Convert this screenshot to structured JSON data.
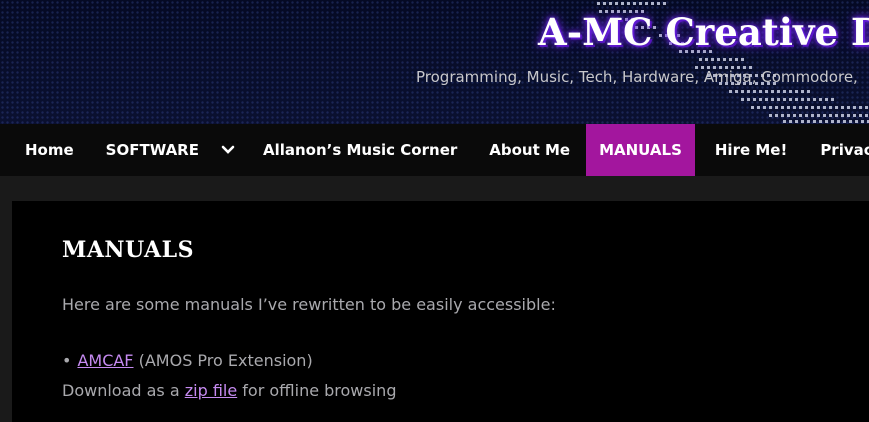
{
  "header": {
    "site_title": "A-MC Creative Dev",
    "tagline": "Programming, Music, Tech, Hardware, Amiga, Commodore,"
  },
  "nav": {
    "items": [
      {
        "label": "Home"
      },
      {
        "label": "SOFTWARE"
      },
      {
        "label": "Allanon’s Music Corner"
      },
      {
        "label": "About Me"
      },
      {
        "label": "MANUALS"
      },
      {
        "label": "Hire Me!"
      },
      {
        "label": "Privacy Po"
      }
    ],
    "active_color": "#a3169e"
  },
  "main": {
    "title": "MANUALS",
    "intro": "Here are some manuals I’ve rewritten to be easily accessible:",
    "list": [
      {
        "bullet": "•",
        "link": "AMCAF",
        "suffix": " (AMOS Pro Extension)"
      }
    ],
    "download": {
      "prefix": "Download as a ",
      "link": "zip file",
      "suffix": " for offline browsing"
    }
  },
  "colors": {
    "link": "#c58af0",
    "header_bg": "#050a24",
    "title_glow": "#7a2cff"
  }
}
